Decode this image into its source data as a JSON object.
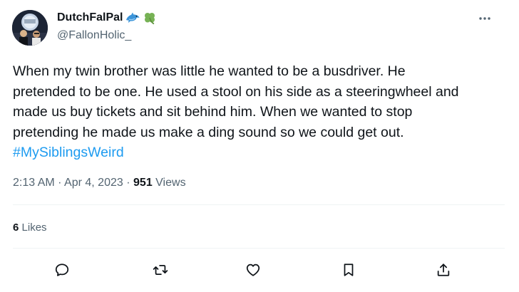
{
  "author": {
    "display_name": "DutchFalPal",
    "name_emoji": [
      "dolphin-emoji",
      "four-leaf-clover-emoji"
    ],
    "handle": "@FallonHolic_"
  },
  "tweet": {
    "text_lines": [
      "When my twin brother was little he wanted to be a busdriver. He",
      "pretended to be one. He used a stool on his side as a steeringwheel and",
      "made us buy tickets and sit behind him. When we wanted to stop",
      "pretending he made us make a ding sound so we could get out."
    ],
    "hashtag": "#MySiblingsWeird",
    "time": "2:13 AM",
    "date": "Apr 4, 2023",
    "separator": "·",
    "views_count": "951",
    "views_label": "Views"
  },
  "engagement": {
    "likes_count": "6",
    "likes_label": "Likes"
  },
  "actions": [
    {
      "icon": "reply-icon"
    },
    {
      "icon": "retweet-icon"
    },
    {
      "icon": "like-icon"
    },
    {
      "icon": "bookmark-icon"
    },
    {
      "icon": "share-icon"
    }
  ],
  "colors": {
    "link": "#1d9bf0",
    "secondary_text": "#536471",
    "primary_text": "#0f1419",
    "divider": "#eff3f4",
    "dolphin": "#3b94d9",
    "clover": "#77b255"
  }
}
